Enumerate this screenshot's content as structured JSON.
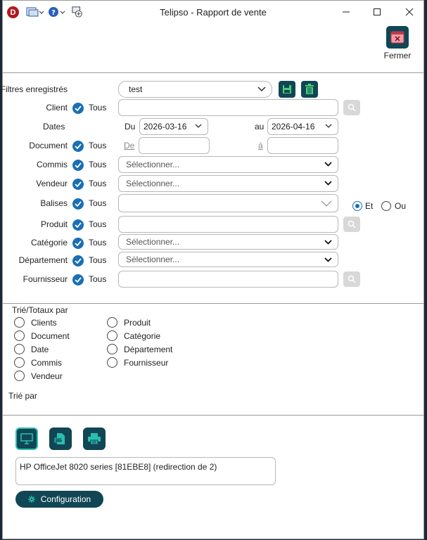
{
  "window": {
    "title": "Telipso - Rapport de vente",
    "logo_letter": "D"
  },
  "toolbar": {
    "close_label": "Fermer"
  },
  "filters": {
    "saved": {
      "label": "Filtres enregistrés",
      "value": "test"
    },
    "client": {
      "label": "Client",
      "all": "Tous"
    },
    "dates": {
      "label": "Dates",
      "from_label": "Du",
      "from_value": "2026-03-16",
      "to_label": "au",
      "to_value": "2026-04-16"
    },
    "document": {
      "label": "Document",
      "all": "Tous",
      "from_label": "De",
      "to_label": "à"
    },
    "commis": {
      "label": "Commis",
      "all": "Tous",
      "placeholder": "Sélectionner..."
    },
    "vendeur": {
      "label": "Vendeur",
      "all": "Tous",
      "placeholder": "Sélectionner..."
    },
    "balises": {
      "label": "Balises",
      "all": "Tous",
      "and_label": "Et",
      "or_label": "Ou",
      "selected_logic": "Et"
    },
    "produit": {
      "label": "Produit",
      "all": "Tous"
    },
    "categorie": {
      "label": "Catégorie",
      "all": "Tous",
      "placeholder": "Sélectionner..."
    },
    "departement": {
      "label": "Département",
      "all": "Tous",
      "placeholder": "Sélectionner..."
    },
    "fournisseur": {
      "label": "Fournisseur",
      "all": "Tous"
    }
  },
  "sort": {
    "title": "Trié/Totaux par",
    "col1": [
      "Clients",
      "Document",
      "Date",
      "Commis",
      "Vendeur"
    ],
    "col2": [
      "Produit",
      "Catégorie",
      "Département",
      "Fournisseur"
    ],
    "sorted_by_label": "Trié par"
  },
  "output": {
    "printer": "HP OfficeJet 8020 series [81EBE8] (redirection de 2)",
    "config_label": "Configuration"
  },
  "colors": {
    "accent": "#114654",
    "check": "#1a6fb5",
    "active_border": "#2bbfb0"
  }
}
